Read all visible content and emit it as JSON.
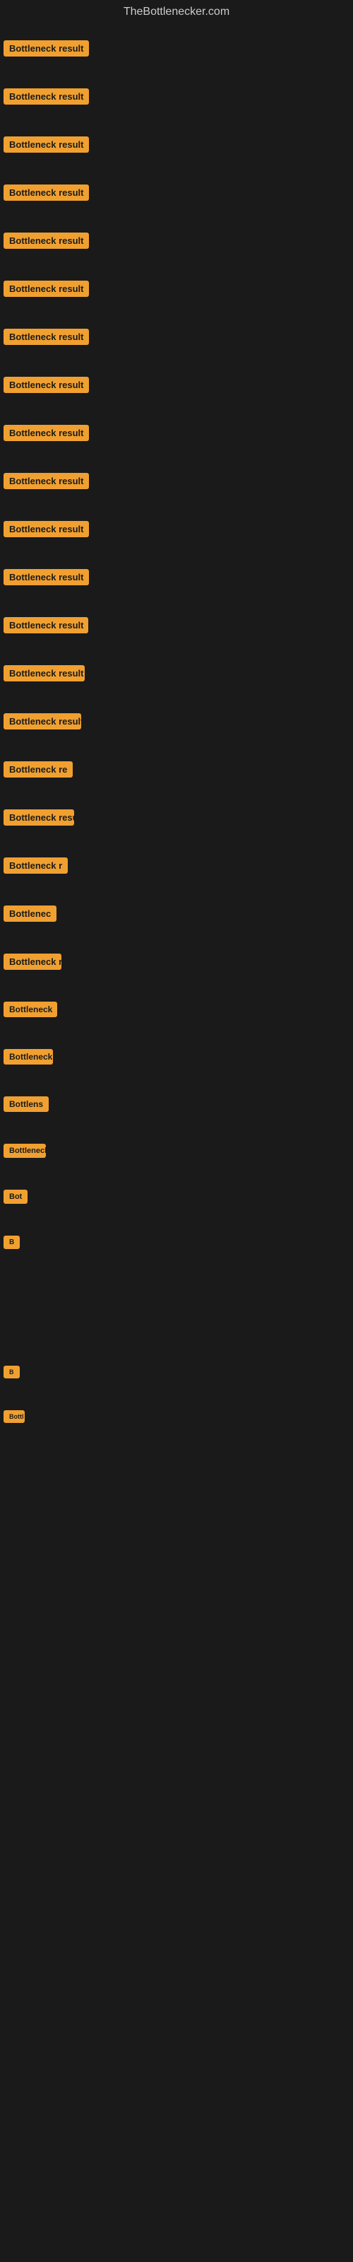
{
  "site": {
    "title": "TheBottlenecker.com"
  },
  "items": [
    {
      "id": 1,
      "label": "Bottleneck result",
      "gap": "small"
    },
    {
      "id": 2,
      "label": "Bottleneck result",
      "gap": "medium"
    },
    {
      "id": 3,
      "label": "Bottleneck result",
      "gap": "medium"
    },
    {
      "id": 4,
      "label": "Bottleneck result",
      "gap": "medium"
    },
    {
      "id": 5,
      "label": "Bottleneck result",
      "gap": "medium"
    },
    {
      "id": 6,
      "label": "Bottleneck result",
      "gap": "medium"
    },
    {
      "id": 7,
      "label": "Bottleneck result",
      "gap": "medium"
    },
    {
      "id": 8,
      "label": "Bottleneck result",
      "gap": "medium"
    },
    {
      "id": 9,
      "label": "Bottleneck result",
      "gap": "medium"
    },
    {
      "id": 10,
      "label": "Bottleneck result",
      "gap": "medium"
    },
    {
      "id": 11,
      "label": "Bottleneck result",
      "gap": "medium"
    },
    {
      "id": 12,
      "label": "Bottleneck result",
      "gap": "medium"
    },
    {
      "id": 13,
      "label": "Bottleneck result",
      "gap": "medium"
    },
    {
      "id": 14,
      "label": "Bottleneck result",
      "gap": "medium"
    },
    {
      "id": 15,
      "label": "Bottleneck result",
      "gap": "medium"
    },
    {
      "id": 16,
      "label": "Bottleneck re",
      "gap": "medium"
    },
    {
      "id": 17,
      "label": "Bottleneck result",
      "gap": "medium"
    },
    {
      "id": 18,
      "label": "Bottleneck r",
      "gap": "medium"
    },
    {
      "id": 19,
      "label": "Bottlenec",
      "gap": "medium"
    },
    {
      "id": 20,
      "label": "Bottleneck r",
      "gap": "medium"
    },
    {
      "id": 21,
      "label": "Bottleneck",
      "gap": "medium"
    },
    {
      "id": 22,
      "label": "Bottleneck res",
      "gap": "medium"
    },
    {
      "id": 23,
      "label": "Bottlens",
      "gap": "medium"
    },
    {
      "id": 24,
      "label": "Bottleneck",
      "gap": "medium"
    },
    {
      "id": 25,
      "label": "Bot",
      "gap": "medium"
    },
    {
      "id": 26,
      "label": "B",
      "gap": "medium"
    },
    {
      "id": 27,
      "label": "",
      "gap": "xl"
    },
    {
      "id": 28,
      "label": "B",
      "gap": "large"
    },
    {
      "id": 29,
      "label": "Bottl",
      "gap": "medium"
    },
    {
      "id": 30,
      "label": "",
      "gap": "xxl"
    },
    {
      "id": 31,
      "label": "",
      "gap": "xxl"
    },
    {
      "id": 32,
      "label": "",
      "gap": "xxl"
    },
    {
      "id": 33,
      "label": "",
      "gap": "xxl"
    }
  ],
  "colors": {
    "badge_bg": "#f0a030",
    "badge_text": "#1a1a1a",
    "background": "#1a1a1a",
    "title_text": "#cccccc"
  }
}
